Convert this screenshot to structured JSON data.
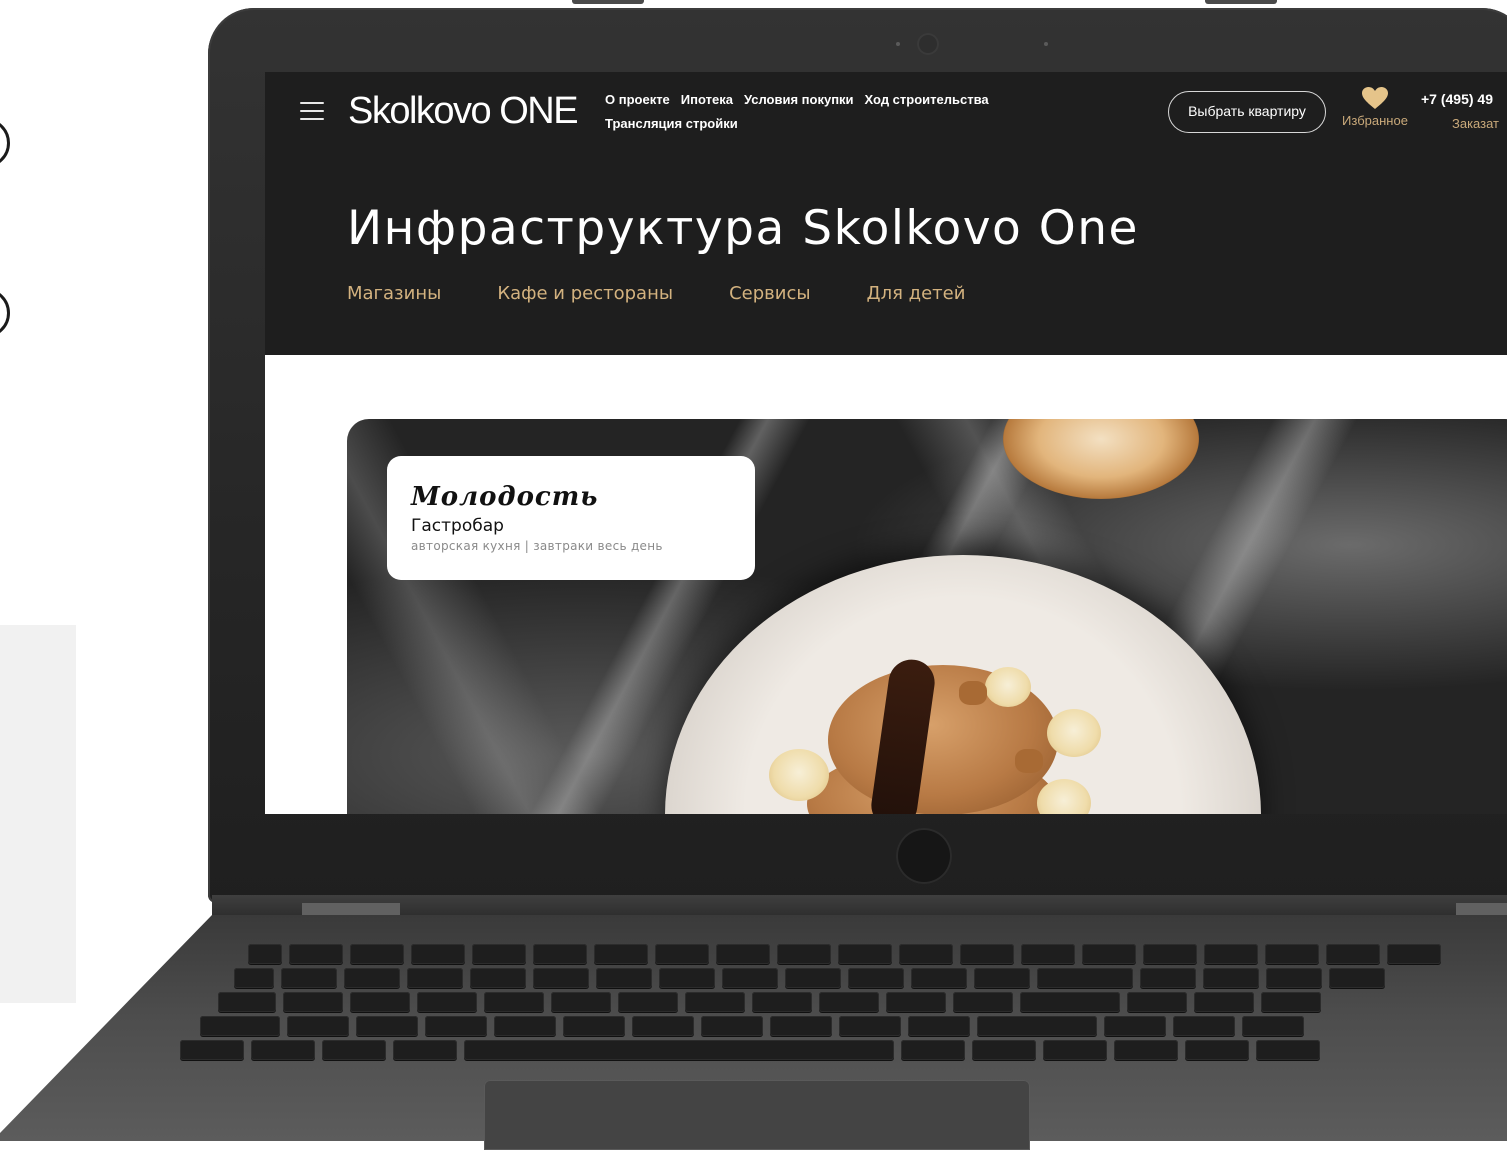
{
  "site": {
    "logo": "Skolkovo ONE",
    "nav_links": [
      "О проекте",
      "Ипотека",
      "Условия покупки",
      "Ход строительства",
      "Трансляция стройки"
    ],
    "choose_button": "Выбрать квартиру",
    "favorites_label": "Избранное",
    "phone": "+7 (495) 49",
    "order_call": "Заказат"
  },
  "hero": {
    "title": "Инфраструктура Skolkovo One",
    "categories": [
      "Магазины",
      "Кафе и рестораны",
      "Сервисы",
      "Для детей"
    ]
  },
  "venue": {
    "name": "Молодость",
    "type": "Гастробар",
    "description": "авторская кухня | завтраки весь день"
  },
  "colors": {
    "header_bg": "#1e1e1e",
    "accent_gold": "#d3b27f",
    "laptop_body": "#2b2b2b"
  },
  "icons": {
    "menu": "hamburger-icon",
    "favorites": "heart-icon"
  }
}
